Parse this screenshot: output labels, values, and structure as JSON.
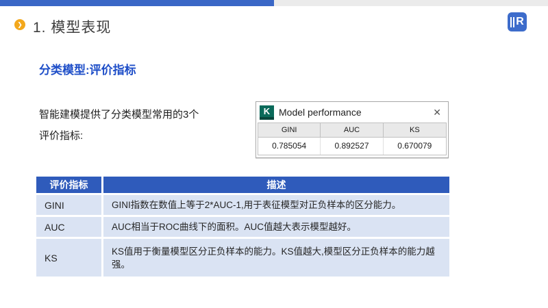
{
  "slide": {
    "title": "1. 模型表现",
    "bullet_glyph": "❯",
    "subtitle": "分类模型:评价指标",
    "body_line1": "智能建模提供了分类模型常用的3个",
    "body_line2": "评价指标:",
    "logo_letter": "R"
  },
  "dialog": {
    "icon_letter": "K",
    "title": "Model performance",
    "close_glyph": "✕",
    "columns": [
      "GINI",
      "AUC",
      "KS"
    ],
    "values": [
      "0.785054",
      "0.892527",
      "0.670079"
    ]
  },
  "metrics_table": {
    "headers": [
      "评价指标",
      "描述"
    ],
    "rows": [
      {
        "name": "GINI",
        "desc": "GINI指数在数值上等于2*AUC-1,用于表征模型对正负样本的区分能力。"
      },
      {
        "name": "AUC",
        "desc": "AUC相当于ROC曲线下的面积。AUC值越大表示模型越好。"
      },
      {
        "name": "KS",
        "desc": "KS值用于衡量模型区分正负样本的能力。KS值越大,模型区分正负样本的能力越强。"
      }
    ]
  },
  "colors": {
    "topbar_blue": "#3a67c6",
    "topbar_gray": "#ebebeb",
    "bullet_orange": "#f3a81c",
    "logo_blue": "#3d6ccb",
    "subtitle_blue": "#1e4ec8",
    "table_header_blue": "#2f5bbb",
    "table_row_light_blue": "#dae3f3",
    "dialog_icon_teal": "#0a6a5a"
  }
}
